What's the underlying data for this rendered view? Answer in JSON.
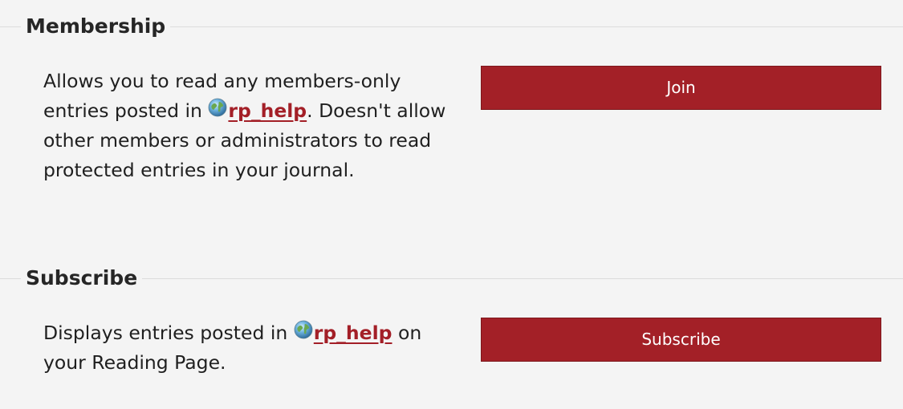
{
  "membership": {
    "title": "Membership",
    "desc_before": "Allows you to read any members-only entries posted in ",
    "username": "rp_help",
    "desc_after": ". Doesn't allow other members or administrators to read protected entries in your journal.",
    "button_label": "Join"
  },
  "subscribe": {
    "title": "Subscribe",
    "desc_before": "Displays entries posted in ",
    "username": "rp_help",
    "desc_after": " on your Reading Page.",
    "button_label": "Subscribe"
  },
  "colors": {
    "accent": "#a32027",
    "background": "#f4f4f4",
    "link": "#a31f27"
  },
  "icons": {
    "user_icon": "globe-icon"
  }
}
